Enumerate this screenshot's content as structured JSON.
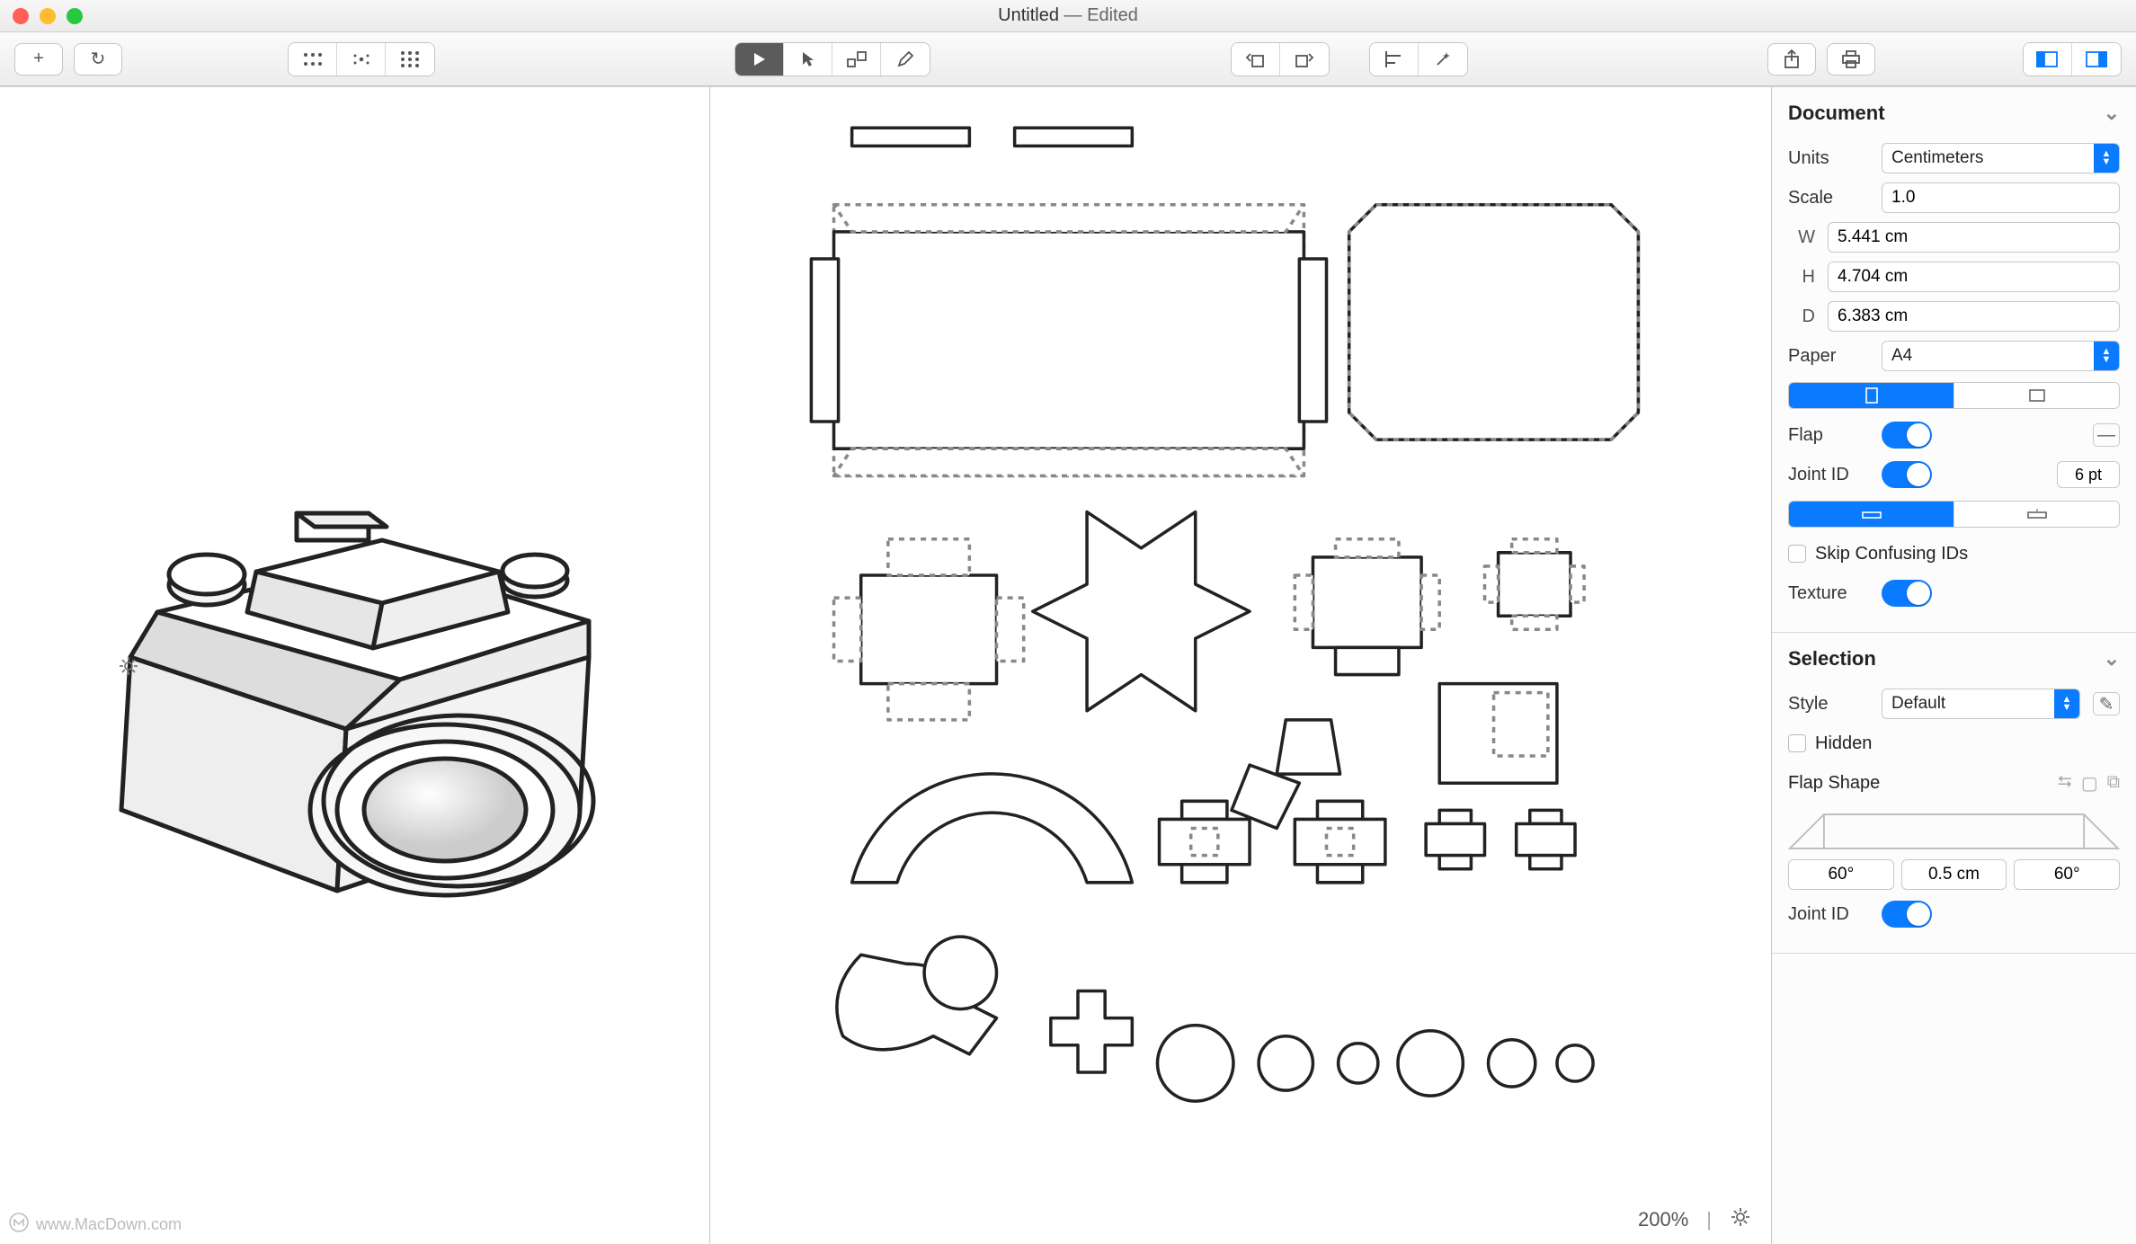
{
  "title": {
    "name": "Untitled",
    "status": "Edited"
  },
  "toolbar": {
    "add": "+",
    "reload": "↻",
    "zoom_pct": "200%"
  },
  "inspector": {
    "document": {
      "header": "Document",
      "units_label": "Units",
      "units_value": "Centimeters",
      "scale_label": "Scale",
      "scale_value": "1.0",
      "w_label": "W",
      "w_value": "5.441 cm",
      "h_label": "H",
      "h_value": "4.704 cm",
      "d_label": "D",
      "d_value": "6.383 cm",
      "paper_label": "Paper",
      "paper_value": "A4",
      "flap_label": "Flap",
      "flap_on": true,
      "jointid_label": "Joint ID",
      "jointid_on": true,
      "jointid_size": "6 pt",
      "skip_label": "Skip Confusing IDs",
      "texture_label": "Texture",
      "texture_on": true
    },
    "selection": {
      "header": "Selection",
      "style_label": "Style",
      "style_value": "Default",
      "hidden_label": "Hidden",
      "flapshape_label": "Flap Shape",
      "flap_angle_left": "60°",
      "flap_size": "0.5 cm",
      "flap_angle_right": "60°",
      "jointid_label": "Joint ID",
      "jointid_on": true
    }
  },
  "watermark": "www.MacDown.com"
}
